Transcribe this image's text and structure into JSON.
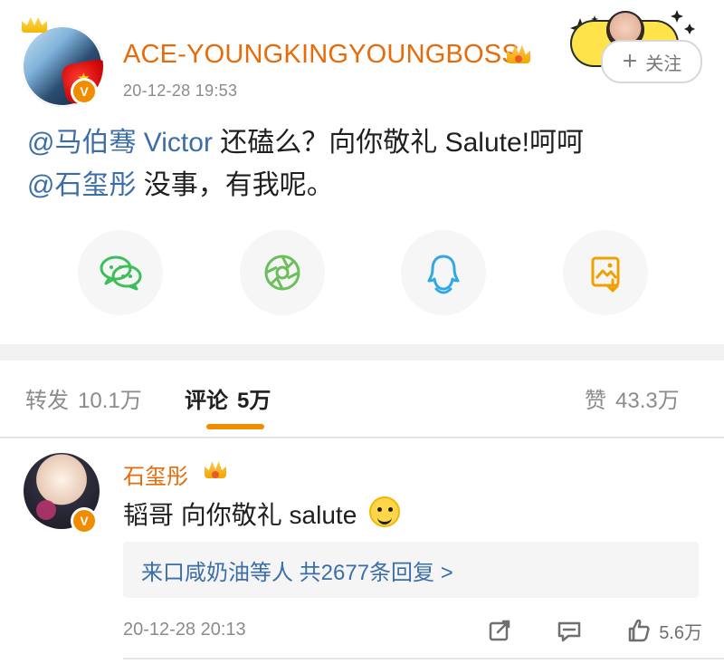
{
  "post": {
    "username": "ACE-YOUNGKINGYOUNGBOSS",
    "timestamp": "20-12-28 19:53",
    "follow_label": "关注",
    "follow_plus": "+",
    "text_lines": [
      [
        {
          "kind": "mention",
          "text": "@马伯骞 Victor"
        },
        {
          "kind": "normal",
          "text": " 还磕么？向你敬礼 Salute!呵呵"
        }
      ],
      [
        {
          "kind": "mention",
          "text": "@石玺彤"
        },
        {
          "kind": "normal",
          "text": " 没事，有我呢。"
        }
      ]
    ],
    "share_icons": [
      "wechat-icon",
      "moments-icon",
      "qq-icon",
      "save-image-icon"
    ],
    "avatar_badge": "V"
  },
  "tabs": {
    "reposts_label": "转发",
    "reposts_count": "10.1万",
    "comments_label": "评论",
    "comments_count": "5万",
    "likes_label": "赞",
    "likes_count": "43.3万"
  },
  "comment": {
    "username": "石玺彤",
    "avatar_badge": "V",
    "text": "韬哥 向你敬礼 salute",
    "replies_summary": "来口咸奶油等人 共2677条回复 >",
    "timestamp": "20-12-28 20:13",
    "like_count": "5.6万",
    "action_icons": [
      "share-icon",
      "reply-icon",
      "like-icon"
    ]
  },
  "colors": {
    "orange": "#e86b0a",
    "mention_blue": "#3b6ea8",
    "muted": "#8b8b8b",
    "accent_underline": "#f08c00",
    "wechat_green": "#3cbf5b",
    "moments_green": "#6abf5a",
    "qq_blue": "#31a8e6",
    "save_orange": "#f0a000"
  }
}
